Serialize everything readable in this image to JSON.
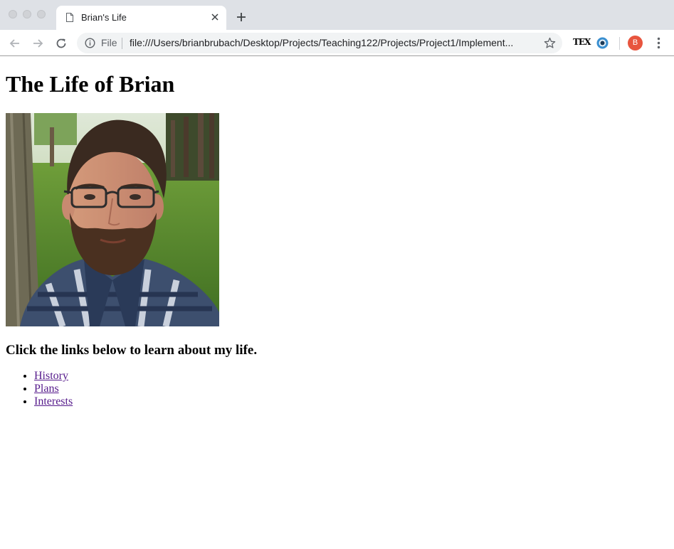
{
  "browser": {
    "tab": {
      "title": "Brian's Life",
      "icon": "document-icon"
    },
    "omnibox": {
      "scheme_label": "File",
      "url": "file:///Users/brianbrubach/Desktop/Projects/Teaching122/Projects/Project1/Implement..."
    },
    "extensions": {
      "tex_label": "TEX"
    },
    "profile": {
      "initial": "B",
      "color": "#e8553e"
    }
  },
  "page": {
    "heading": "The Life of Brian",
    "photo": {
      "icon": "portrait-photo"
    },
    "subheading": "Click the links below to learn about my life.",
    "links": [
      {
        "label": "History"
      },
      {
        "label": "Plans"
      },
      {
        "label": "Interests"
      }
    ],
    "link_color": "#551a8b"
  }
}
